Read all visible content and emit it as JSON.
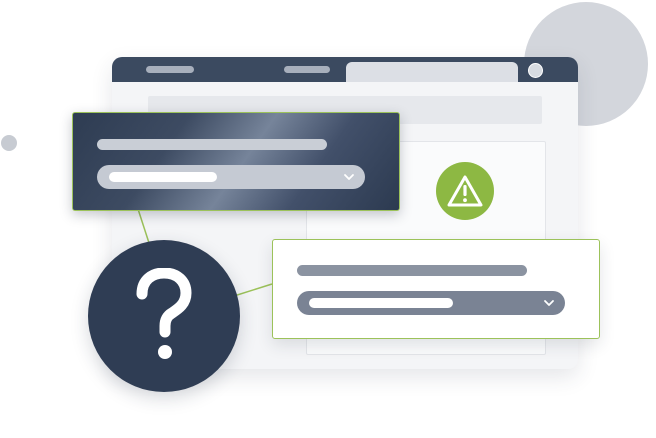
{
  "colors": {
    "accent_green": "#8db843",
    "navy": "#2f3d54",
    "window_bar": "#3b4a60",
    "background_gray": "#d3d6dc"
  },
  "icons": {
    "warning": "warning-triangle-icon",
    "help": "question-mark-icon",
    "dropdown": "chevron-down-icon"
  }
}
